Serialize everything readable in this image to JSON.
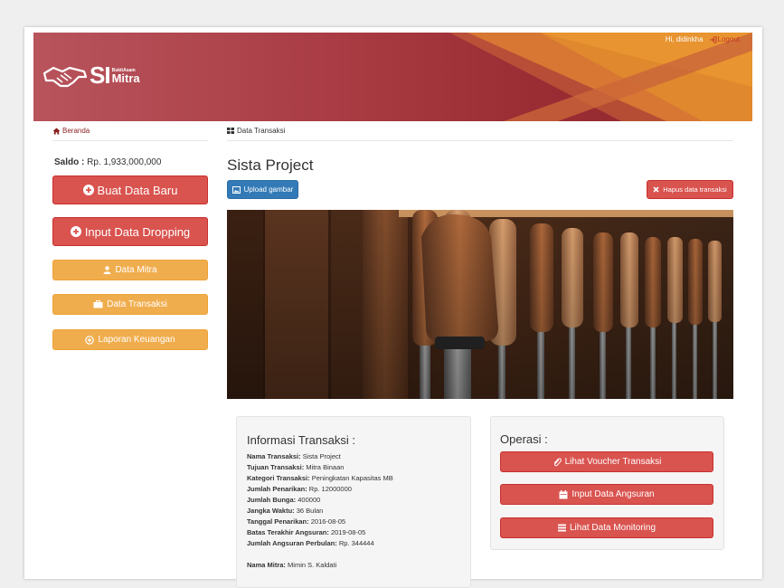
{
  "header": {
    "logo_text": "SI",
    "logo_subtext": "BukitAsam",
    "logo_mitra": "Mitra",
    "greeting": "Hi, didinkha",
    "logout_label": "Logout"
  },
  "breadcrumb_left": "Beranda",
  "breadcrumb_right": "Data Transaksi",
  "saldo": {
    "label": "Saldo :",
    "value": "Rp. 1,933,000,000"
  },
  "sidebar": {
    "buat_data_baru": "Buat Data Baru",
    "input_data_dropping": "Input Data Dropping",
    "data_mitra": "Data Mitra",
    "data_transaksi": "Data Transaksi",
    "laporan_keuangan": "Laporan Keuangan"
  },
  "main": {
    "title": "Sista Project",
    "upload_label": "Upload gambar",
    "delete_label": "Hapus data transaksi"
  },
  "info": {
    "heading": "Informasi Transaksi :",
    "rows": [
      {
        "label": "Nama Transaksi:",
        "value": "Sista Project"
      },
      {
        "label": "Tujuan Transaksi:",
        "value": "Mitra Binaan"
      },
      {
        "label": "Kategori Transaksi:",
        "value": "Peningkatan Kapasitas MB"
      },
      {
        "label": "Jumlah Penarikan:",
        "value": "Rp. 12000000"
      },
      {
        "label": "Jumlah Bunga:",
        "value": "400000"
      },
      {
        "label": "Jangka Waktu:",
        "value": "36 Bulan"
      },
      {
        "label": "Tanggal Penarikan:",
        "value": "2016-08-05"
      },
      {
        "label": "Batas Terakhir Angsuran:",
        "value": "2019-08-05"
      },
      {
        "label": "Jumlah Angsuran Perbulan:",
        "value": "Rp. 344444"
      }
    ],
    "mitra_label": "Nama Mitra:",
    "mitra_value": "Mimin S. Kaldati"
  },
  "operasi": {
    "heading": "Operasi :",
    "voucher": "Lihat Voucher Transaksi",
    "angsuran": "Input Data Angsuran",
    "monitoring": "Lihat Data Monitoring"
  },
  "colors": {
    "red": "#d9534f",
    "orange": "#f0ad4e",
    "blue": "#337ab7",
    "banner": "#a83a42"
  }
}
